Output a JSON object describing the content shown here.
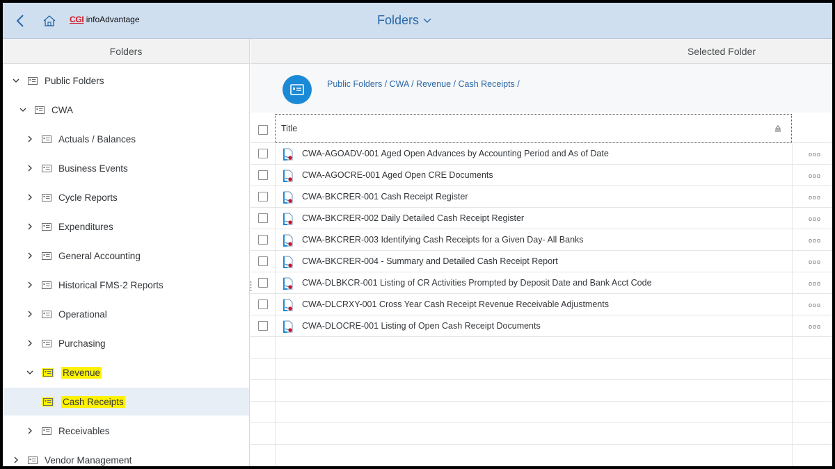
{
  "header": {
    "brand_prefix": "CGI",
    "brand_name": "infoAdvantage",
    "title": "Folders",
    "accent": "#2a68a8"
  },
  "left_pane": {
    "title": "Folders",
    "tree": [
      {
        "label": "Public Folders",
        "expanded": true,
        "level": 0
      },
      {
        "label": "CWA",
        "expanded": true,
        "level": 1
      },
      {
        "label": "Actuals / Balances",
        "expanded": false,
        "level": 2
      },
      {
        "label": "Business Events",
        "expanded": false,
        "level": 2
      },
      {
        "label": "Cycle Reports",
        "expanded": false,
        "level": 2
      },
      {
        "label": "Expenditures",
        "expanded": false,
        "level": 2
      },
      {
        "label": "General Accounting",
        "expanded": false,
        "level": 2
      },
      {
        "label": "Historical FMS-2 Reports",
        "expanded": false,
        "level": 2
      },
      {
        "label": "Operational",
        "expanded": false,
        "level": 2
      },
      {
        "label": "Purchasing",
        "expanded": false,
        "level": 2
      },
      {
        "label": "Revenue",
        "expanded": true,
        "level": 2,
        "highlighted": true
      },
      {
        "label": "Cash Receipts",
        "level": 3,
        "selected": true,
        "highlighted": true
      },
      {
        "label": "Receivables",
        "expanded": false,
        "level": 3
      },
      {
        "label": "Vendor Management",
        "expanded": false,
        "level": 1
      }
    ]
  },
  "right_pane": {
    "title": "Selected Folder",
    "breadcrumb": "Public Folders / CWA / Revenue / Cash Receipts /",
    "table": {
      "column_title": "Title",
      "rows": [
        "CWA-AGOADV-001 Aged Open Advances by Accounting Period and As of Date",
        "CWA-AGOCRE-001 Aged Open CRE Documents",
        "CWA-BKCRER-001 Cash Receipt Register",
        "CWA-BKCRER-002 Daily Detailed Cash Receipt Register",
        "CWA-BKCRER-003 Identifying Cash Receipts for a Given Day- All Banks",
        "CWA-BKCRER-004 - Summary and Detailed Cash Receipt Report",
        "CWA-DLBKCR-001 Listing of CR Activities Prompted by Deposit Date and Bank Acct Code",
        "CWA-DLCRXY-001 Cross Year Cash Receipt Revenue Receivable Adjustments",
        "CWA-DLOCRE-001 Listing of Open Cash Receipt Documents"
      ],
      "more_label": "ooo"
    }
  },
  "icons": {
    "back": "chevron-left-icon",
    "home": "home-icon",
    "folder": "folder-icon",
    "document": "webi-document-icon",
    "sort": "sort-icon"
  }
}
